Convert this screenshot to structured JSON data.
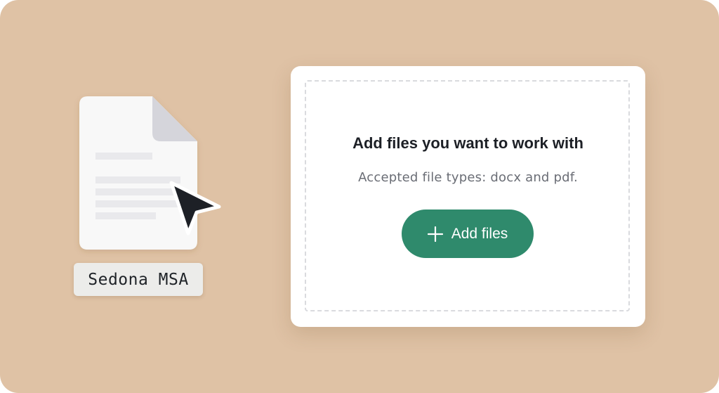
{
  "file": {
    "name": "Sedona MSA",
    "icon": "document-icon"
  },
  "pointer": {
    "icon": "cursor-arrow-icon"
  },
  "upload": {
    "title": "Add files you want to work with",
    "subtitle": "Accepted file types: docx and pdf.",
    "button_label": "Add files",
    "button_icon": "plus-icon"
  },
  "colors": {
    "background": "#dfc2a5",
    "accent": "#2f8a6c",
    "card": "#ffffff"
  }
}
